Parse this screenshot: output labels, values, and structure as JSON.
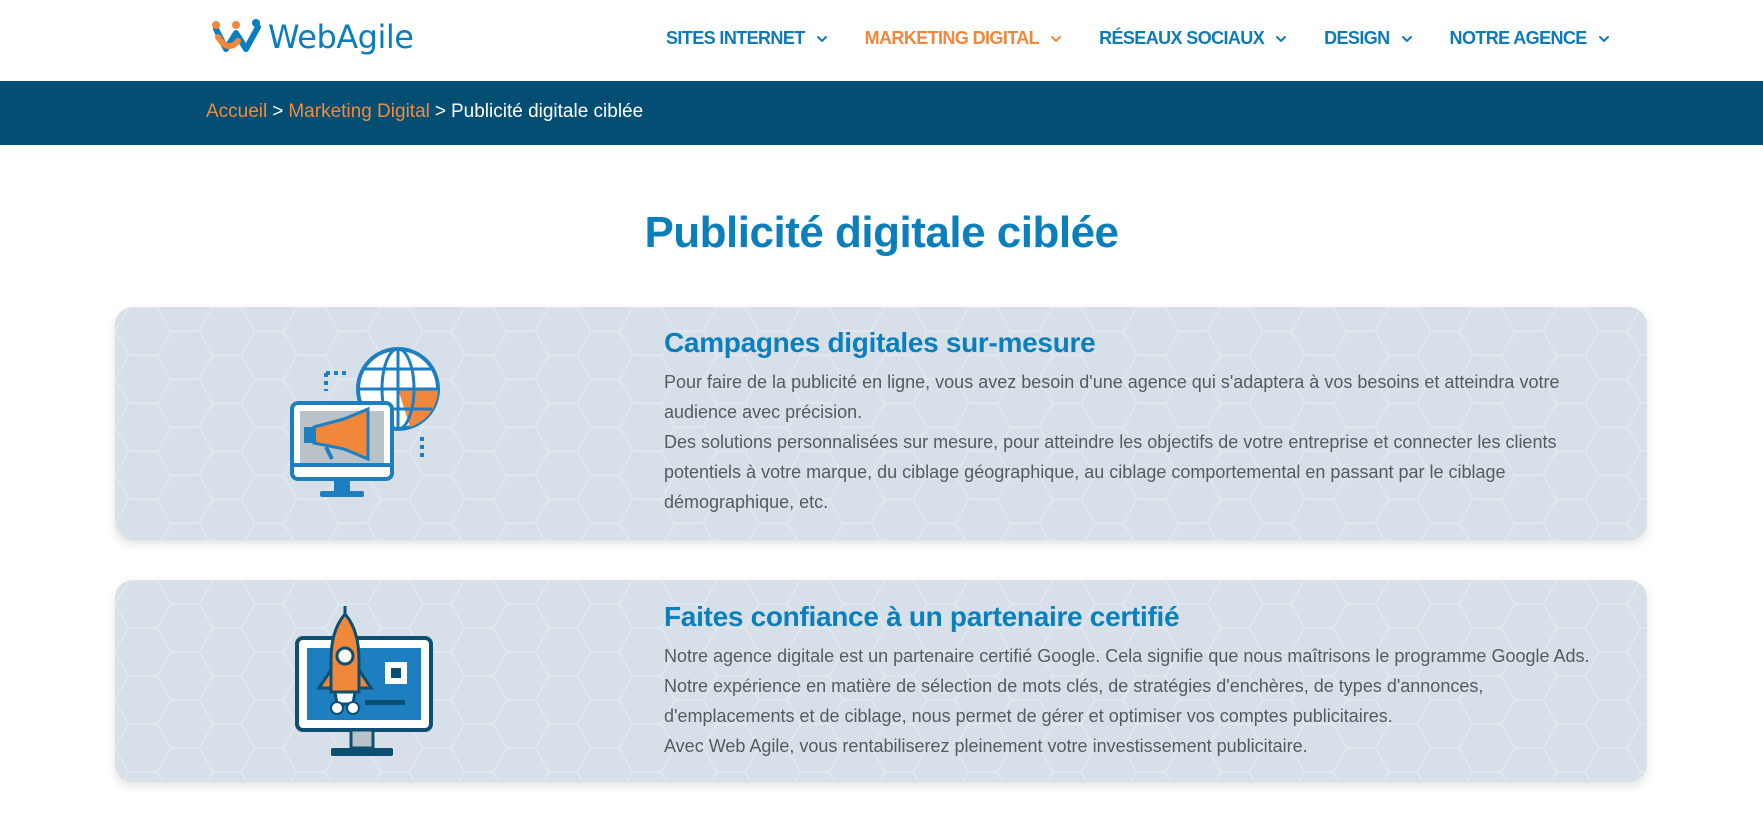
{
  "brand": {
    "logo_text": "WebAgile"
  },
  "nav": {
    "items": [
      {
        "label": "SITES INTERNET"
      },
      {
        "label": "MARKETING DIGITAL"
      },
      {
        "label": "RÉSEAUX SOCIAUX"
      },
      {
        "label": "DESIGN"
      },
      {
        "label": "NOTRE AGENCE"
      }
    ],
    "active_index": 1
  },
  "breadcrumb": {
    "home": "Accueil",
    "parent": "Marketing Digital",
    "current": "Publicité digitale ciblée",
    "separator": ">"
  },
  "page": {
    "title": "Publicité digitale ciblée"
  },
  "cards": [
    {
      "heading": "Campagnes digitales sur-mesure",
      "icon": "monitor-megaphone-globe-icon",
      "paragraphs": [
        "Pour faire de la publicité en ligne, vous avez besoin d'une agence qui s'adaptera à vos besoins et atteindra votre audience avec précision.",
        "Des solutions personnalisées sur mesure, pour atteindre les objectifs de votre entreprise et connecter les clients potentiels à votre marque, du ciblage géographique, au ciblage comportemental en passant par le ciblage démographique, etc."
      ]
    },
    {
      "heading": "Faites confiance à un partenaire certifié",
      "icon": "monitor-rocket-icon",
      "paragraphs": [
        "Notre agence digitale est un partenaire certifié Google. Cela signifie que nous maîtrisons le programme Google Ads.",
        "Notre expérience en matière de sélection de mots clés, de stratégies d'enchères, de types d'annonces, d'emplacements et de ciblage, nous permet de gérer et optimiser vos comptes publicitaires.",
        "Avec Web Agile, vous rentabiliserez pleinement votre investissement publicitaire."
      ]
    }
  ],
  "colors": {
    "brand_blue": "#0b7fbb",
    "accent_orange": "#f0873a",
    "breadcrumb_bg": "#044d73",
    "card_bg": "#d7e0e8"
  }
}
